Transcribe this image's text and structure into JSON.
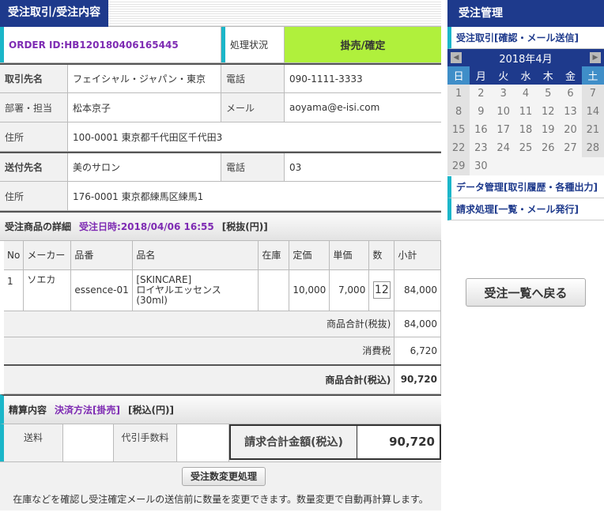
{
  "main": {
    "title": "受注取引/受注内容",
    "order_id": "ORDER ID:HB120180406165445",
    "status_label": "処理状況",
    "status_value": "掛売/確定",
    "customer": {
      "name_label": "取引先名",
      "name": "フェイシャル・ジャパン・東京",
      "phone_label": "電話",
      "phone": "090-1111-3333",
      "dept_label": "部署・担当",
      "dept": "松本京子",
      "mail_label": "メール",
      "mail": "aoyama@e-isi.com",
      "addr_label": "住所",
      "addr": "100-0001 東京都千代田区千代田3"
    },
    "shipping": {
      "name_label": "送付先名",
      "name": "美のサロン",
      "phone_label": "電話",
      "phone": "03",
      "addr_label": "住所",
      "addr": "176-0001 東京都練馬区練馬1"
    },
    "items_section": {
      "title": "受注商品の詳細",
      "date": "受注日時:2018/04/06 16:55",
      "tax": "[税抜(円)]"
    },
    "table_headers": [
      "No",
      "メーカー",
      "品番",
      "品名",
      "在庫",
      "定価",
      "単価",
      "数",
      "小計"
    ],
    "items": [
      {
        "no": "1",
        "maker": "ソエカ",
        "code": "essence-01",
        "name_line1": "[SKINCARE]",
        "name_line2": "ロイヤルエッセンス",
        "name_line3": "(30ml)",
        "stock": "",
        "list_price": "10,000",
        "unit_price": "7,000",
        "qty": "12",
        "subtotal": "84,000"
      }
    ],
    "totals": {
      "subtotal_label": "商品合計(税抜)",
      "subtotal": "84,000",
      "tax_label": "消費税",
      "tax": "6,720",
      "total_label": "商品合計(税込)",
      "total": "90,720"
    },
    "settlement": {
      "title": "精算内容",
      "method": "決済方法[掛売]",
      "tax": "[税込(円)]"
    },
    "fees": {
      "shipping_label": "送料",
      "shipping": "",
      "cod_label": "代引手数料",
      "cod": "",
      "grand_label": "請求合計金額(税込)",
      "grand": "90,720"
    },
    "change_button": "受注数変更処理",
    "note": "在庫などを確認し受注確定メールの送信前に数量を変更できます。数量変更で自動再計算します。"
  },
  "sidebar": {
    "title": "受注管理",
    "link1": "受注取引[確認・メール送信]",
    "calendar": {
      "month": "2018年4月",
      "prev": "◀",
      "next": "▶",
      "weekdays": [
        "日",
        "月",
        "火",
        "水",
        "木",
        "金",
        "土"
      ],
      "days": [
        "1",
        "2",
        "3",
        "4",
        "5",
        "6",
        "7",
        "8",
        "9",
        "10",
        "11",
        "12",
        "13",
        "14",
        "15",
        "16",
        "17",
        "18",
        "19",
        "20",
        "21",
        "22",
        "23",
        "24",
        "25",
        "26",
        "27",
        "28",
        "29",
        "30"
      ]
    },
    "link2": "データ管理[取引履歴・各種出力]",
    "link3": "請求処理[一覧・メール発行]",
    "back_button": "受注一覧へ戻る"
  }
}
